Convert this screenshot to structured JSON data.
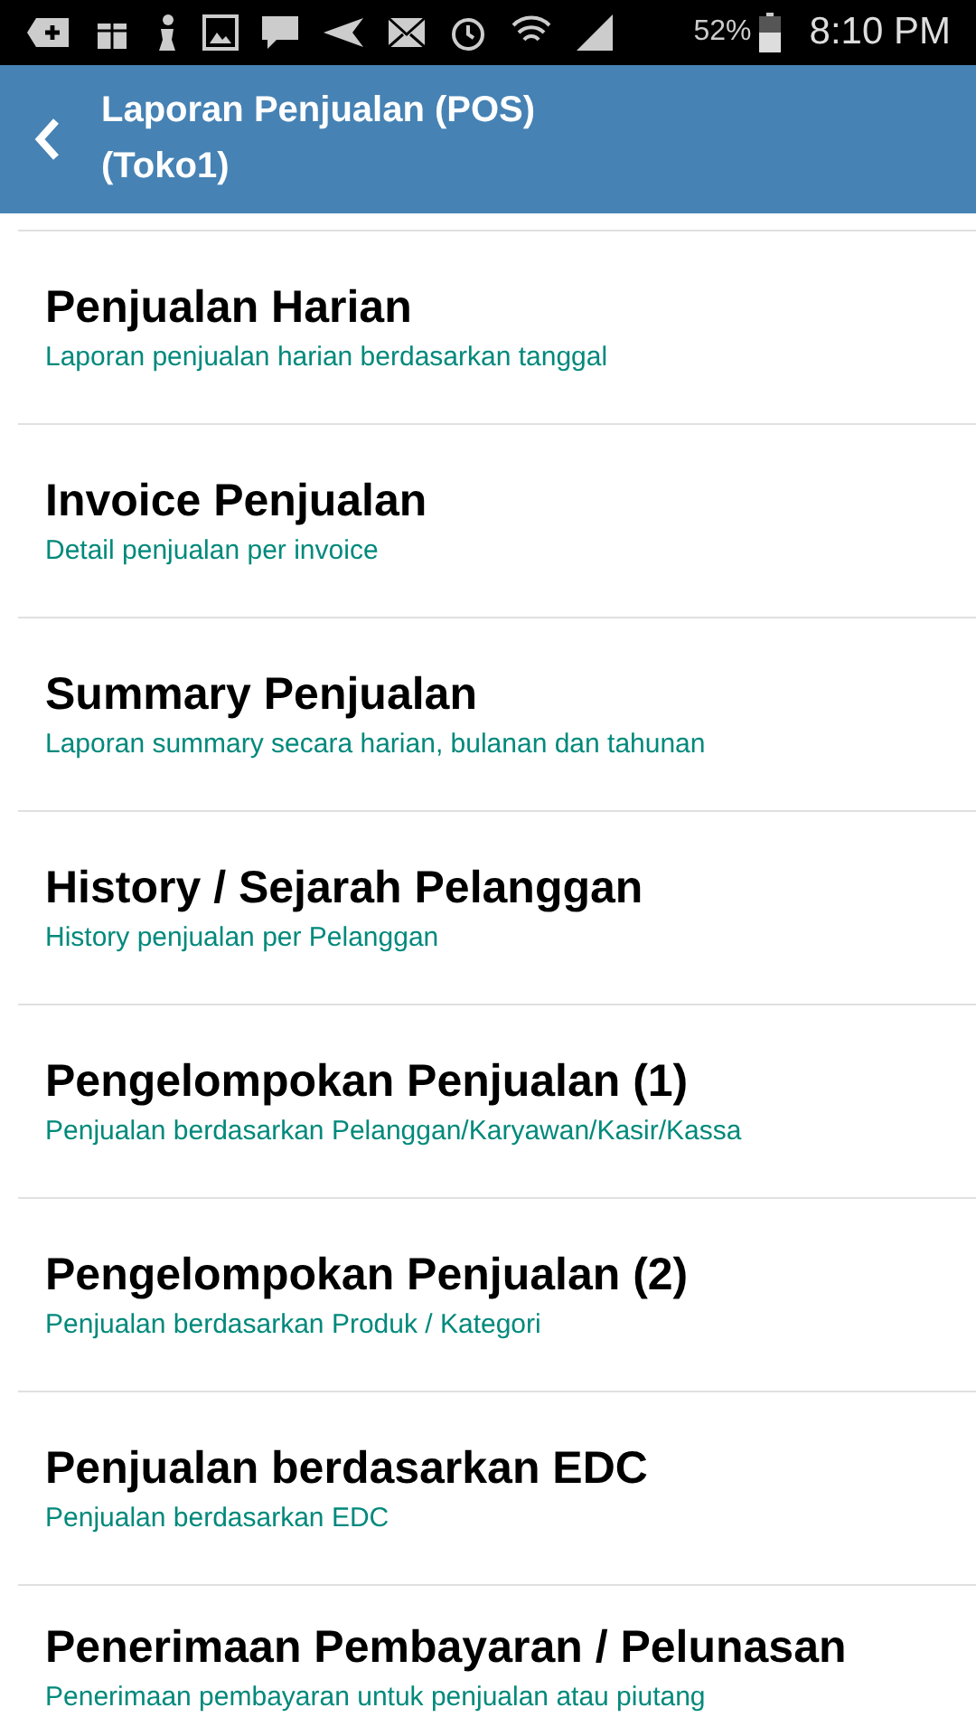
{
  "status_bar": {
    "battery": "52%",
    "time": "8:10 PM"
  },
  "app_bar": {
    "title": "Laporan Penjualan (POS)",
    "subtitle": "(Toko1)"
  },
  "menu_items": [
    {
      "title": "Penjualan Harian",
      "description": "Laporan penjualan harian berdasarkan tanggal"
    },
    {
      "title": "Invoice Penjualan",
      "description": "Detail penjualan per invoice"
    },
    {
      "title": "Summary Penjualan",
      "description": "Laporan summary secara harian, bulanan dan tahunan"
    },
    {
      "title": "History / Sejarah Pelanggan",
      "description": "History penjualan per Pelanggan"
    },
    {
      "title": "Pengelompokan Penjualan (1)",
      "description": "Penjualan berdasarkan Pelanggan/Karyawan/Kasir/Kassa"
    },
    {
      "title": "Pengelompokan Penjualan (2)",
      "description": "Penjualan berdasarkan Produk / Kategori"
    },
    {
      "title": "Penjualan berdasarkan EDC",
      "description": "Penjualan berdasarkan EDC"
    },
    {
      "title": "Penerimaan Pembayaran / Pelunasan",
      "description": "Penerimaan pembayaran untuk penjualan atau piutang"
    }
  ]
}
